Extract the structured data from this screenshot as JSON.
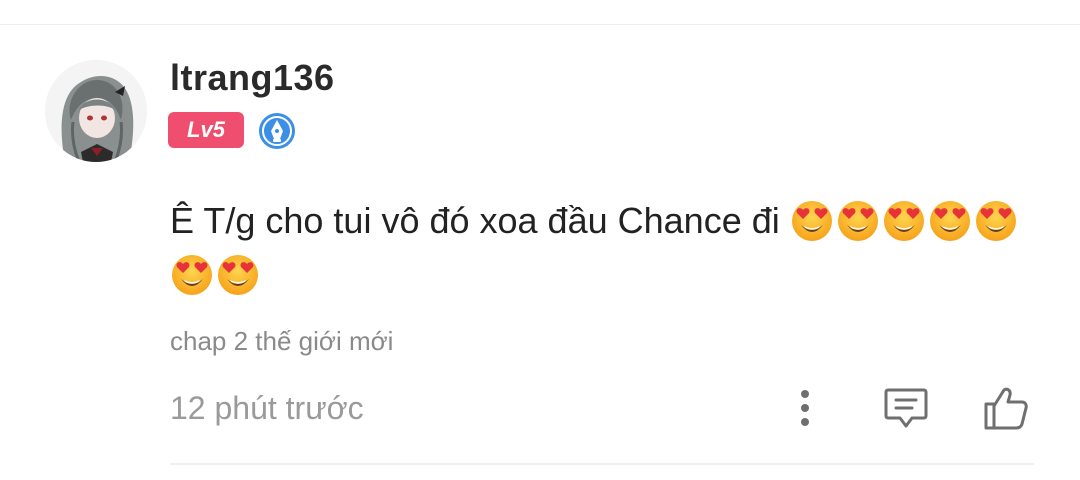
{
  "comment": {
    "username": "ltrang136",
    "level": "Lv5",
    "text": "Ê T/g cho tui vô đó xoa đầu Chance đi",
    "emojis": [
      "heart-eyes-emoji",
      "heart-eyes-emoji",
      "heart-eyes-emoji",
      "heart-eyes-emoji",
      "heart-eyes-emoji",
      "heart-eyes-emoji",
      "heart-eyes-emoji"
    ],
    "chapter": "chap 2 thế giới mới",
    "time": "12 phút trước"
  },
  "icons": {
    "author_badge": "pen-nib-badge-icon",
    "more": "more-vertical-icon",
    "reply": "comment-reply-icon",
    "like": "thumbs-up-icon"
  },
  "colors": {
    "level_badge": "#f04e6e",
    "author_badge": "#3b8fe6",
    "text": "#222222",
    "muted": "#9a9a9a",
    "icon": "#6f6f6f"
  }
}
